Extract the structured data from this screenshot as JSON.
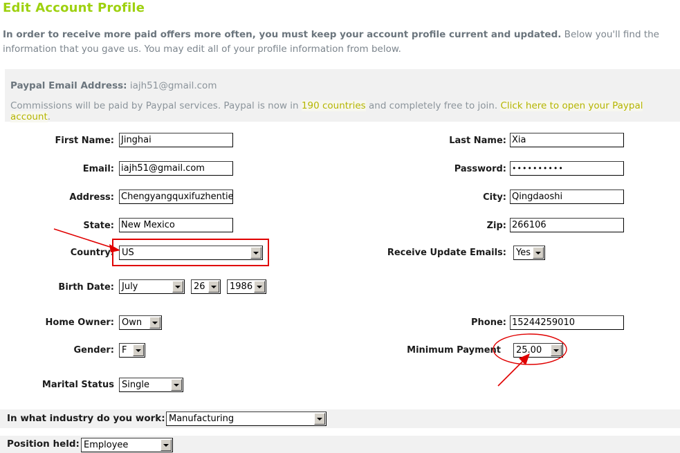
{
  "page": {
    "title": "Edit Account Profile",
    "intro_strong": "In order to receive more paid offers more often, you must keep your account profile current and updated.",
    "intro_rest": " Below you'll find the information that you gave us. You may edit all of your profile information from below."
  },
  "paypal": {
    "email_label": "Paypal Email Address:",
    "email_value": "iajh51@gmail.com",
    "note_part1": "Commissions will be paid by Paypal services. Paypal is now in ",
    "note_link1": "190 countries",
    "note_part2": " and completely free to join. ",
    "note_link2": "Click here to open your Paypal account",
    "note_part3": "."
  },
  "form": {
    "first_name": {
      "label": "First Name:",
      "value": "Jinghai"
    },
    "last_name": {
      "label": "Last Name:",
      "value": "Xia"
    },
    "email": {
      "label": "Email:",
      "value": "iajh51@gmail.com"
    },
    "password": {
      "label": "Password:",
      "value": "••••••••••"
    },
    "address": {
      "label": "Address:",
      "value": "Chengyangquxifuzhentie"
    },
    "city": {
      "label": "City:",
      "value": "Qingdaoshi"
    },
    "state": {
      "label": "State:",
      "value": "New Mexico"
    },
    "zip": {
      "label": "Zip:",
      "value": "266106"
    },
    "country": {
      "label": "Country:",
      "value": "US"
    },
    "receive_update_emails": {
      "label": "Receive Update Emails:",
      "value": "Yes"
    },
    "birth_date": {
      "label": "Birth Date:",
      "month": "July",
      "day": "26",
      "year": "1986"
    },
    "home_owner": {
      "label": "Home Owner:",
      "value": "Own"
    },
    "phone": {
      "label": "Phone:",
      "value": "15244259010"
    },
    "gender": {
      "label": "Gender:",
      "value": "F"
    },
    "minimum_payment": {
      "label": "Minimum Payment",
      "value": "25.00"
    },
    "marital_status": {
      "label": "Marital Status",
      "value": "Single"
    },
    "industry": {
      "label": "In what industry do you work:",
      "value": "Manufacturing"
    },
    "position": {
      "label": "Position held:",
      "value": "Employee"
    }
  },
  "annotations": {
    "country_box_color": "#e00000",
    "ellipse_color": "#e00000",
    "arrow_color": "#e00000"
  }
}
